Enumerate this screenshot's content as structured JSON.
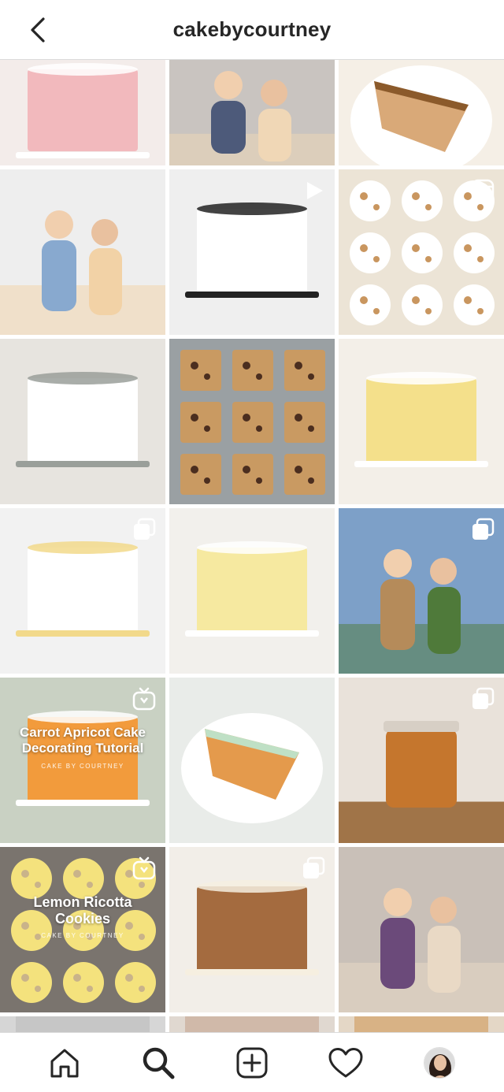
{
  "header": {
    "title": "cakebycourtney"
  },
  "tiles": [
    {
      "name": "pink-sprinkle-cake",
      "badge": "none",
      "colors": [
        "#f3ecea",
        "#f2b9bd",
        "#ffffff"
      ]
    },
    {
      "name": "selfie-two-women",
      "badge": "none",
      "colors": [
        "#c9c4c0",
        "#4d5a7a",
        "#f0d7b6"
      ]
    },
    {
      "name": "layer-cake-slice",
      "badge": "none",
      "colors": [
        "#f5efe6",
        "#d9a978",
        "#8b5a2b"
      ]
    },
    {
      "name": "couple-in-kitchen",
      "badge": "none",
      "colors": [
        "#eeeeee",
        "#88a9cf",
        "#f2d2a6"
      ]
    },
    {
      "name": "floral-black-cake",
      "badge": "video",
      "colors": [
        "#efefef",
        "#ffffff",
        "#222222"
      ]
    },
    {
      "name": "cinnamon-rolls",
      "badge": "reel",
      "colors": [
        "#ece4d6",
        "#ffffff",
        "#c9965f"
      ]
    },
    {
      "name": "striped-white-cake",
      "badge": "none",
      "colors": [
        "#e7e4df",
        "#ffffff",
        "#9a9f9a"
      ]
    },
    {
      "name": "chocolate-chip-bars",
      "badge": "none",
      "colors": [
        "#9aa0a3",
        "#c99a62",
        "#4b2e1f"
      ]
    },
    {
      "name": "yellow-frosted-cake",
      "badge": "none",
      "colors": [
        "#f3efe8",
        "#f4e08b",
        "#ffffff"
      ]
    },
    {
      "name": "woman-slicing-cake",
      "badge": "carousel",
      "colors": [
        "#f2f2f2",
        "#ffffff",
        "#f2d98b"
      ]
    },
    {
      "name": "daisy-ombre-cake",
      "badge": "none",
      "colors": [
        "#f2f0ec",
        "#f6e9a0",
        "#ffffff"
      ]
    },
    {
      "name": "family-in-desert",
      "badge": "carousel",
      "colors": [
        "#7da0c8",
        "#b58b5a",
        "#4f7a3a"
      ]
    },
    {
      "name": "carrot-apricot-cake",
      "badge": "igtv",
      "colors": [
        "#c9d1c3",
        "#f29b3c",
        "#ffffff"
      ],
      "overlay": {
        "title": "Carrot Apricot Cake Decorating Tutorial",
        "sub": "CAKE BY COURTNEY"
      }
    },
    {
      "name": "carrot-cake-slice",
      "badge": "none",
      "colors": [
        "#e9ece9",
        "#e49a4c",
        "#bfe0c5"
      ]
    },
    {
      "name": "caramel-jar",
      "badge": "carousel",
      "colors": [
        "#e9e2da",
        "#c5762d",
        "#a07448"
      ]
    },
    {
      "name": "lemon-ricotta-cookies",
      "badge": "igtv",
      "colors": [
        "#7a746e",
        "#f4e27d",
        "#c9b38a"
      ],
      "overlay": {
        "title": "Lemon Ricotta Cookies",
        "sub": "CAKE BY COURTNEY"
      }
    },
    {
      "name": "pecan-cake",
      "badge": "carousel",
      "colors": [
        "#f2eee8",
        "#a46b3f",
        "#f6efe0"
      ]
    },
    {
      "name": "family-outdoors",
      "badge": "none",
      "colors": [
        "#c9c0b8",
        "#6b4a7a",
        "#e9d9c5"
      ]
    },
    {
      "name": "partial-tile-1",
      "badge": "none",
      "colors": [
        "#d6d6d6",
        "#bbbbbb",
        "#cccccc"
      ]
    },
    {
      "name": "partial-tile-2",
      "badge": "none",
      "colors": [
        "#e0d8d0",
        "#c4a58f",
        "#d0c4b6"
      ]
    },
    {
      "name": "partial-tile-3",
      "badge": "none",
      "colors": [
        "#e4d7c6",
        "#d19a5a",
        "#f0e6d8"
      ]
    }
  ],
  "nav": {
    "items": [
      "home-icon",
      "search-icon",
      "new-post-icon",
      "activity-heart-icon",
      "profile-avatar"
    ],
    "active": "search-icon"
  }
}
